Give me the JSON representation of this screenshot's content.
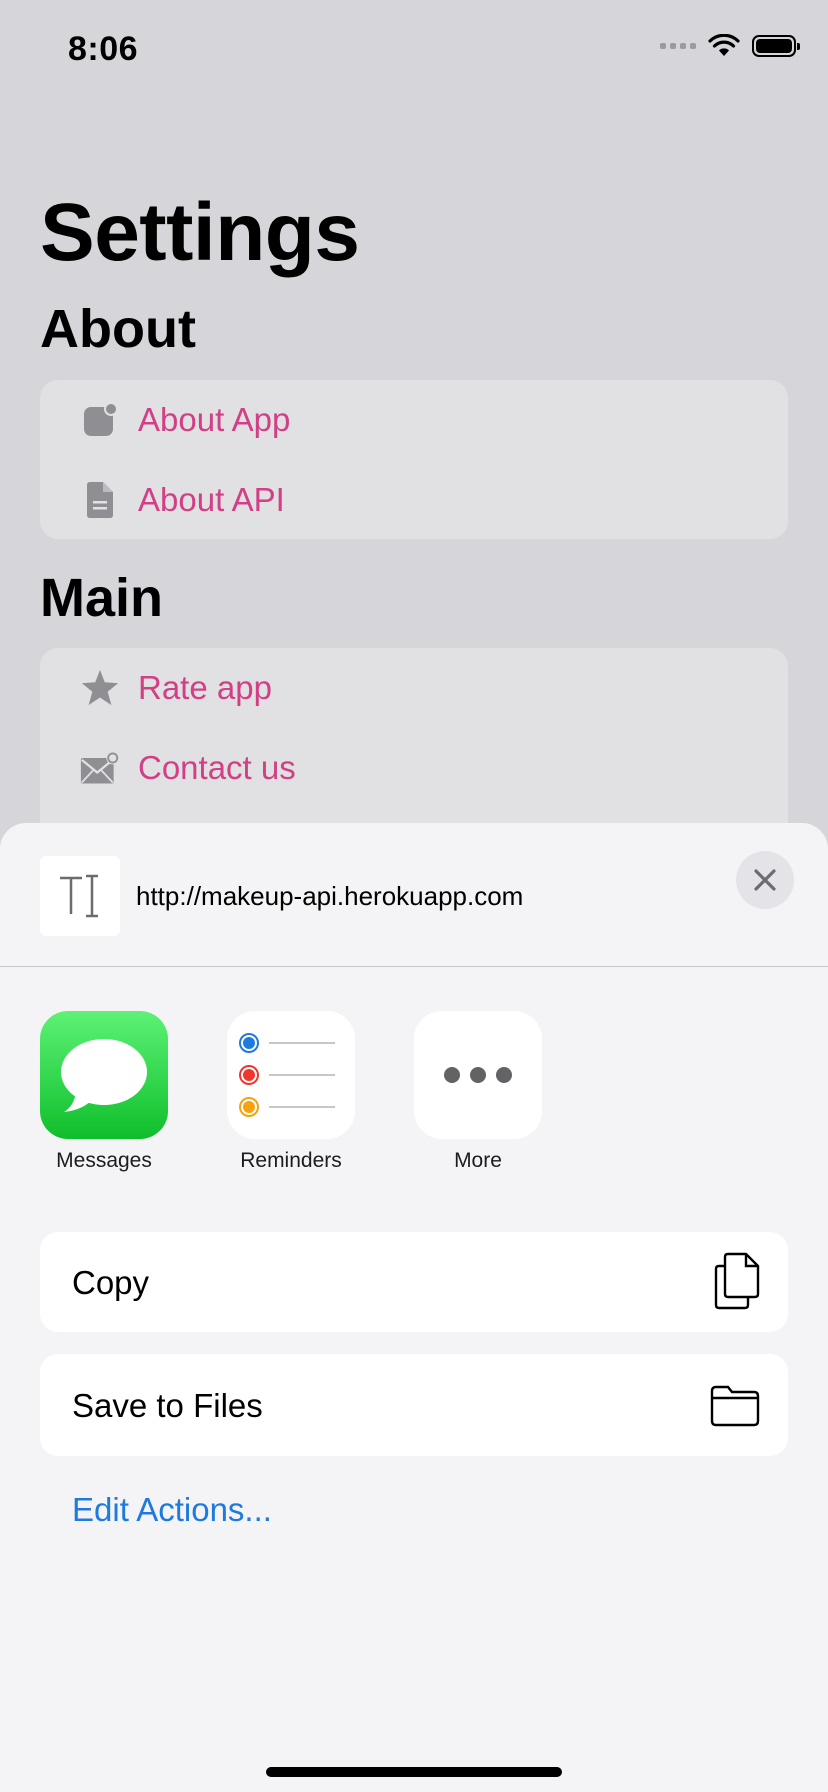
{
  "status_bar": {
    "time": "8:06"
  },
  "settings": {
    "title": "Settings",
    "sections": [
      {
        "title": "About",
        "items": [
          {
            "label": "About App",
            "icon": "app-badge-icon"
          },
          {
            "label": "About API",
            "icon": "document-icon"
          }
        ]
      },
      {
        "title": "Main",
        "items": [
          {
            "label": "Rate app",
            "icon": "star-icon"
          },
          {
            "label": "Contact us",
            "icon": "envelope-badge-icon"
          }
        ]
      }
    ],
    "accent_color": "#d23f86"
  },
  "share_sheet": {
    "url": "http://makeup-api.herokuapp.com",
    "apps": [
      {
        "name": "Messages",
        "icon": "messages-icon"
      },
      {
        "name": "Reminders",
        "icon": "reminders-icon"
      },
      {
        "name": "More",
        "icon": "more-icon"
      }
    ],
    "actions": [
      {
        "label": "Copy",
        "icon": "copy-icon"
      },
      {
        "label": "Save to Files",
        "icon": "folder-icon"
      }
    ],
    "edit_actions": "Edit Actions...",
    "link_color": "#1f7ae0"
  }
}
